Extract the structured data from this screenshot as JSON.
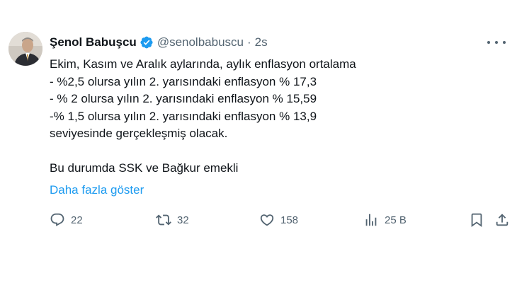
{
  "author": {
    "name": "Şenol Babuşcu",
    "handle": "@senolbabuscu",
    "separator": "·",
    "time": "2s"
  },
  "tweet": {
    "lines": [
      "Ekim, Kasım ve Aralık aylarında, aylık enflasyon ortalama",
      "- %2,5 olursa yılın 2. yarısındaki enflasyon % 17,3",
      "- % 2 olursa yılın 2. yarısındaki enflasyon % 15,59",
      "-% 1,5 olursa yılın 2. yarısındaki enflasyon % 13,9",
      "seviyesinde gerçekleşmiş olacak.",
      "",
      "Bu durumda SSK ve Bağkur emekli"
    ],
    "show_more": "Daha fazla göster"
  },
  "actions": {
    "replies": "22",
    "retweets": "32",
    "likes": "158",
    "views": "25 B"
  },
  "colors": {
    "verified": "#1d9bf0",
    "link": "#1d9bf0",
    "muted": "#536471"
  }
}
